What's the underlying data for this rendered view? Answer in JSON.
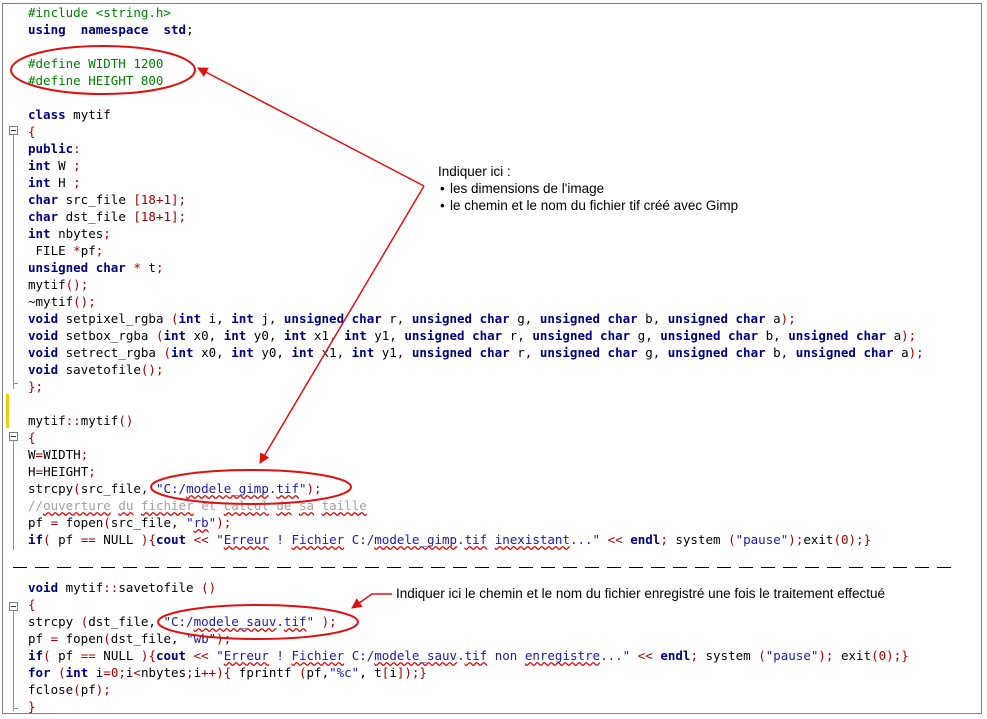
{
  "colors": {
    "annotation": "#e01010",
    "keyword": "#00007f",
    "preprocessor": "#008000",
    "string": "#1a1aa6",
    "number": "#a00000",
    "comment": "#a0a0a0"
  },
  "code_top": [
    [
      [
        "pre",
        "#include <string.h>"
      ]
    ],
    [
      [
        "kw",
        "using"
      ],
      [
        "",
        "  "
      ],
      [
        "kw",
        "namespace"
      ],
      [
        "",
        "  "
      ],
      [
        "kw",
        "std"
      ],
      [
        "",
        ";"
      ]
    ],
    [],
    [
      [
        "pre",
        "#define WIDTH 1200"
      ]
    ],
    [
      [
        "pre",
        "#define HEIGHT 800"
      ]
    ],
    [],
    [
      [
        "kw",
        "class"
      ],
      [
        "",
        " mytif"
      ]
    ],
    [
      [
        "op",
        "{"
      ]
    ],
    [
      [
        "kw",
        "public"
      ],
      [
        "op",
        ":"
      ]
    ],
    [
      [
        "kw",
        "int"
      ],
      [
        "",
        " W "
      ],
      [
        "op",
        ";"
      ]
    ],
    [
      [
        "kw",
        "int"
      ],
      [
        "",
        " H "
      ],
      [
        "op",
        ";"
      ]
    ],
    [
      [
        "kw",
        "char"
      ],
      [
        "",
        " src_file "
      ],
      [
        "op",
        "["
      ],
      [
        "num",
        "18"
      ],
      [
        "op",
        "+"
      ],
      [
        "num",
        "1"
      ],
      [
        "op",
        "];"
      ]
    ],
    [
      [
        "kw",
        "char"
      ],
      [
        "",
        " dst_file "
      ],
      [
        "op",
        "["
      ],
      [
        "num",
        "18"
      ],
      [
        "op",
        "+"
      ],
      [
        "num",
        "1"
      ],
      [
        "op",
        "];"
      ]
    ],
    [
      [
        "kw",
        "int"
      ],
      [
        "",
        " nbytes"
      ],
      [
        "op",
        ";"
      ]
    ],
    [
      [
        "",
        " FILE "
      ],
      [
        "op",
        "*"
      ],
      [
        "",
        "pf"
      ],
      [
        "op",
        ";"
      ]
    ],
    [
      [
        "kw",
        "unsigned char"
      ],
      [
        "",
        " "
      ],
      [
        "op",
        "*"
      ],
      [
        "",
        " t"
      ],
      [
        "op",
        ";"
      ]
    ],
    [
      [
        "",
        "mytif"
      ],
      [
        "op",
        "();"
      ]
    ],
    [
      [
        "",
        "~mytif"
      ],
      [
        "op",
        "();"
      ]
    ],
    [
      [
        "kw",
        "void"
      ],
      [
        "",
        " setpixel_rgba "
      ],
      [
        "op",
        "("
      ],
      [
        "kw",
        "int"
      ],
      [
        "",
        " i, "
      ],
      [
        "kw",
        "int"
      ],
      [
        "",
        " j, "
      ],
      [
        "kw",
        "unsigned char"
      ],
      [
        "",
        " r, "
      ],
      [
        "kw",
        "unsigned char"
      ],
      [
        "",
        " g, "
      ],
      [
        "kw",
        "unsigned char"
      ],
      [
        "",
        " b, "
      ],
      [
        "kw",
        "unsigned char"
      ],
      [
        "",
        " a"
      ],
      [
        "op",
        ");"
      ]
    ],
    [
      [
        "kw",
        "void"
      ],
      [
        "",
        " setbox_rgba "
      ],
      [
        "op",
        "("
      ],
      [
        "kw",
        "int"
      ],
      [
        "",
        " x0, "
      ],
      [
        "kw",
        "int"
      ],
      [
        "",
        " y0, "
      ],
      [
        "kw",
        "int"
      ],
      [
        "",
        " x1, "
      ],
      [
        "kw",
        "int"
      ],
      [
        "",
        " y1, "
      ],
      [
        "kw",
        "unsigned char"
      ],
      [
        "",
        " r, "
      ],
      [
        "kw",
        "unsigned char"
      ],
      [
        "",
        " g, "
      ],
      [
        "kw",
        "unsigned char"
      ],
      [
        "",
        " b, "
      ],
      [
        "kw",
        "unsigned char"
      ],
      [
        "",
        " a"
      ],
      [
        "op",
        ");"
      ]
    ],
    [
      [
        "kw",
        "void"
      ],
      [
        "",
        " setrect_rgba "
      ],
      [
        "op",
        "("
      ],
      [
        "kw",
        "int"
      ],
      [
        "",
        " x0, "
      ],
      [
        "kw",
        "int"
      ],
      [
        "",
        " y0, "
      ],
      [
        "kw",
        "int"
      ],
      [
        "",
        " x1, "
      ],
      [
        "kw",
        "int"
      ],
      [
        "",
        " y1, "
      ],
      [
        "kw",
        "unsigned char"
      ],
      [
        "",
        " r, "
      ],
      [
        "kw",
        "unsigned char"
      ],
      [
        "",
        " g, "
      ],
      [
        "kw",
        "unsigned char"
      ],
      [
        "",
        " b, "
      ],
      [
        "kw",
        "unsigned char"
      ],
      [
        "",
        " a"
      ],
      [
        "op",
        ");"
      ]
    ],
    [
      [
        "kw",
        "void"
      ],
      [
        "",
        " savetofile"
      ],
      [
        "op",
        "();"
      ]
    ],
    [
      [
        "op",
        "};"
      ]
    ],
    [],
    [
      [
        "",
        "mytif"
      ],
      [
        "op",
        "::"
      ],
      [
        "",
        "mytif"
      ],
      [
        "op",
        "()"
      ]
    ],
    [
      [
        "op",
        "{"
      ]
    ],
    [
      [
        "",
        "W"
      ],
      [
        "op",
        "="
      ],
      [
        "",
        "WIDTH"
      ],
      [
        "op",
        ";"
      ]
    ],
    [
      [
        "",
        "H"
      ],
      [
        "op",
        "="
      ],
      [
        "",
        "HEIGHT"
      ],
      [
        "op",
        ";"
      ]
    ],
    [
      [
        "",
        "strcpy"
      ],
      [
        "op",
        "("
      ],
      [
        "",
        "src_file, "
      ],
      [
        "str",
        "\"C:/"
      ],
      [
        "str sq",
        "modele_gimp"
      ],
      [
        "str",
        "."
      ],
      [
        "str sq",
        "tif"
      ],
      [
        "str",
        "\""
      ],
      [
        "op",
        ");"
      ]
    ],
    [
      [
        "cmt",
        "//"
      ],
      [
        "cmt sq",
        "ouverture"
      ],
      [
        "cmt",
        " "
      ],
      [
        "cmt sq",
        "du"
      ],
      [
        "cmt",
        " "
      ],
      [
        "cmt sq",
        "fichier"
      ],
      [
        "cmt",
        " et "
      ],
      [
        "cmt sq",
        "calcul"
      ],
      [
        "cmt",
        " "
      ],
      [
        "cmt sq",
        "de"
      ],
      [
        "cmt",
        " "
      ],
      [
        "cmt sq",
        "sa"
      ],
      [
        "cmt",
        " "
      ],
      [
        "cmt sq",
        "taille"
      ]
    ],
    [
      [
        "",
        "pf "
      ],
      [
        "op",
        "="
      ],
      [
        "",
        " fopen"
      ],
      [
        "op",
        "("
      ],
      [
        "",
        "src_file, "
      ],
      [
        "str",
        "\""
      ],
      [
        "str sq",
        "rb"
      ],
      [
        "str",
        "\""
      ],
      [
        "op",
        ");"
      ]
    ],
    [
      [
        "kw",
        "if"
      ],
      [
        "op",
        "("
      ],
      [
        "",
        " pf "
      ],
      [
        "op",
        "=="
      ],
      [
        "",
        " NULL "
      ],
      [
        "op",
        ")"
      ],
      [
        "op",
        "{"
      ],
      [
        "kw",
        "cout"
      ],
      [
        "",
        " "
      ],
      [
        "op",
        "<<"
      ],
      [
        "",
        " "
      ],
      [
        "str",
        "\""
      ],
      [
        "str sq",
        "Erreur"
      ],
      [
        "str",
        " ! "
      ],
      [
        "str sq",
        "Fichier"
      ],
      [
        "str",
        " C:/"
      ],
      [
        "str sq",
        "modele_gimp"
      ],
      [
        "str",
        "."
      ],
      [
        "str sq",
        "tif"
      ],
      [
        "str",
        " "
      ],
      [
        "str sq",
        "inexistant"
      ],
      [
        "str",
        "...\""
      ],
      [
        "",
        " "
      ],
      [
        "op",
        "<<"
      ],
      [
        "",
        " "
      ],
      [
        "kw",
        "endl"
      ],
      [
        "op",
        ";"
      ],
      [
        "",
        " system "
      ],
      [
        "op",
        "("
      ],
      [
        "str",
        "\"pause\""
      ],
      [
        "op",
        ");"
      ],
      [
        "",
        "exit"
      ],
      [
        "op",
        "("
      ],
      [
        "num",
        "0"
      ],
      [
        "op",
        ");}"
      ]
    ]
  ],
  "code_bottom": [
    [
      [
        "kw",
        "void"
      ],
      [
        "",
        " mytif"
      ],
      [
        "op",
        "::"
      ],
      [
        "",
        "savetofile "
      ],
      [
        "op",
        "()"
      ]
    ],
    [
      [
        "op",
        "{"
      ]
    ],
    [
      [
        "",
        "strcpy "
      ],
      [
        "op",
        "("
      ],
      [
        "",
        "dst_file, "
      ],
      [
        "str",
        "\"C:/"
      ],
      [
        "str sq",
        "modele_sauv"
      ],
      [
        "str",
        "."
      ],
      [
        "str sq",
        "tif"
      ],
      [
        "str",
        "\""
      ],
      [
        "",
        " "
      ],
      [
        "op",
        ");"
      ]
    ],
    [
      [
        "",
        "pf "
      ],
      [
        "op",
        "="
      ],
      [
        "",
        " fopen"
      ],
      [
        "op",
        "("
      ],
      [
        "",
        "dst_file, "
      ],
      [
        "str",
        "\"wb\""
      ],
      [
        "op",
        ");"
      ]
    ],
    [
      [
        "kw",
        "if"
      ],
      [
        "op",
        "("
      ],
      [
        "",
        " pf "
      ],
      [
        "op",
        "=="
      ],
      [
        "",
        " NULL "
      ],
      [
        "op",
        ")"
      ],
      [
        "op",
        "{"
      ],
      [
        "kw",
        "cout"
      ],
      [
        "",
        " "
      ],
      [
        "op",
        "<<"
      ],
      [
        "",
        " "
      ],
      [
        "str",
        "\""
      ],
      [
        "str sq",
        "Erreur"
      ],
      [
        "str",
        " ! "
      ],
      [
        "str sq",
        "Fichier"
      ],
      [
        "str",
        " C:/"
      ],
      [
        "str sq",
        "modele_sauv"
      ],
      [
        "str",
        "."
      ],
      [
        "str sq",
        "tif"
      ],
      [
        "str",
        " non "
      ],
      [
        "str sq",
        "enregistre"
      ],
      [
        "str",
        "...\""
      ],
      [
        "",
        " "
      ],
      [
        "op",
        "<<"
      ],
      [
        "",
        " "
      ],
      [
        "kw",
        "endl"
      ],
      [
        "op",
        ";"
      ],
      [
        "",
        " system "
      ],
      [
        "op",
        "("
      ],
      [
        "str",
        "\"pause\""
      ],
      [
        "op",
        ");"
      ],
      [
        "",
        " exit"
      ],
      [
        "op",
        "("
      ],
      [
        "num",
        "0"
      ],
      [
        "op",
        ");}"
      ]
    ],
    [
      [
        "kw",
        "for"
      ],
      [
        "",
        " "
      ],
      [
        "op",
        "("
      ],
      [
        "kw",
        "int"
      ],
      [
        "",
        " i"
      ],
      [
        "op",
        "="
      ],
      [
        "num",
        "0"
      ],
      [
        "op",
        ";"
      ],
      [
        "",
        "i"
      ],
      [
        "op",
        "<"
      ],
      [
        "",
        "nbytes"
      ],
      [
        "op",
        ";"
      ],
      [
        "",
        "i"
      ],
      [
        "op",
        "++){"
      ],
      [
        "",
        " fprintf "
      ],
      [
        "op",
        "("
      ],
      [
        "",
        "pf,"
      ],
      [
        "str",
        "\"%c\""
      ],
      [
        "",
        ", t"
      ],
      [
        "op",
        "["
      ],
      [
        "",
        "i"
      ],
      [
        "op",
        "]);}"
      ]
    ],
    [
      [
        "",
        "fclose"
      ],
      [
        "op",
        "("
      ],
      [
        "",
        "pf"
      ],
      [
        "op",
        ");"
      ]
    ],
    [
      [
        "op",
        "}"
      ]
    ]
  ],
  "note1": {
    "heading": "Indiquer ici :",
    "items": [
      "les dimensions de l'image",
      "le chemin et le nom du fichier tif créé avec Gimp"
    ]
  },
  "note2": "Indiquer ici le chemin et le nom du fichier enregistré une fois le traitement effectué"
}
